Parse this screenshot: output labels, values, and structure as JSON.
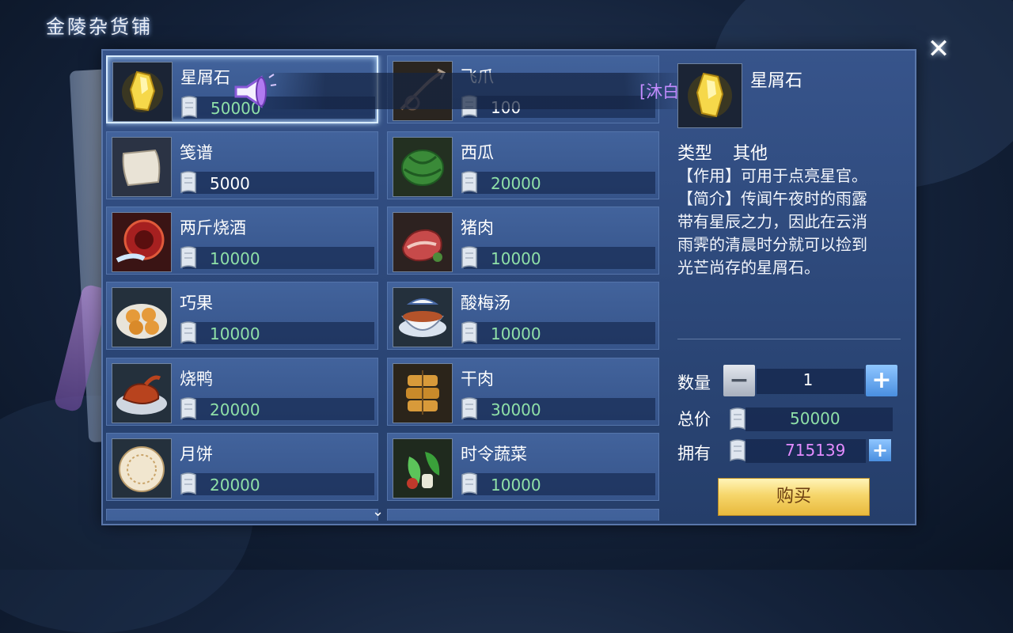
{
  "shop": {
    "title": "金陵杂货铺",
    "close_symbol": "✕"
  },
  "broadcast": {
    "text": "[沐白."
  },
  "items": [
    {
      "name": "星屑石",
      "price": "50000",
      "price_color": "green",
      "icon": "yellow-crystal-icon",
      "selected": true
    },
    {
      "name": "飞爪",
      "price": "100",
      "price_color": "white",
      "icon": "grappling-hook-icon"
    },
    {
      "name": "笺谱",
      "price": "5000",
      "price_color": "white",
      "icon": "paper-scroll-icon"
    },
    {
      "name": "西瓜",
      "price": "20000",
      "price_color": "green",
      "icon": "watermelon-icon"
    },
    {
      "name": "两斤烧酒",
      "price": "10000",
      "price_color": "green",
      "icon": "wine-jar-icon"
    },
    {
      "name": "猪肉",
      "price": "10000",
      "price_color": "green",
      "icon": "pork-icon"
    },
    {
      "name": "巧果",
      "price": "10000",
      "price_color": "green",
      "icon": "pastry-plate-icon"
    },
    {
      "name": "酸梅汤",
      "price": "10000",
      "price_color": "green",
      "icon": "soup-bowl-icon"
    },
    {
      "name": "烧鸭",
      "price": "20000",
      "price_color": "green",
      "icon": "roast-duck-icon"
    },
    {
      "name": "干肉",
      "price": "30000",
      "price_color": "green",
      "icon": "dried-meat-icon"
    },
    {
      "name": "月饼",
      "price": "20000",
      "price_color": "green",
      "icon": "mooncake-icon"
    },
    {
      "name": "时令蔬菜",
      "price": "10000",
      "price_color": "green",
      "icon": "vegetables-icon"
    }
  ],
  "detail": {
    "name": "星屑石",
    "type_label": "类型",
    "type_value": "其他",
    "desc_lines": [
      "【作用】可用于点亮星官。",
      "【简介】传闻午夜时的雨露",
      "带有星辰之力，因此在云消",
      "雨霁的清晨时分就可以捡到",
      "光芒尚存的星屑石。"
    ]
  },
  "purchase": {
    "quantity_label": "数量",
    "quantity": "1",
    "minus": "−",
    "plus": "+",
    "total_label": "总价",
    "total": "50000",
    "owned_label": "拥有",
    "owned": "715139",
    "buy_label": "购买"
  },
  "colors": {
    "green_price": "#8fe0a8",
    "owned_value": "#e38cff",
    "gold_button": "#f6d66b"
  }
}
